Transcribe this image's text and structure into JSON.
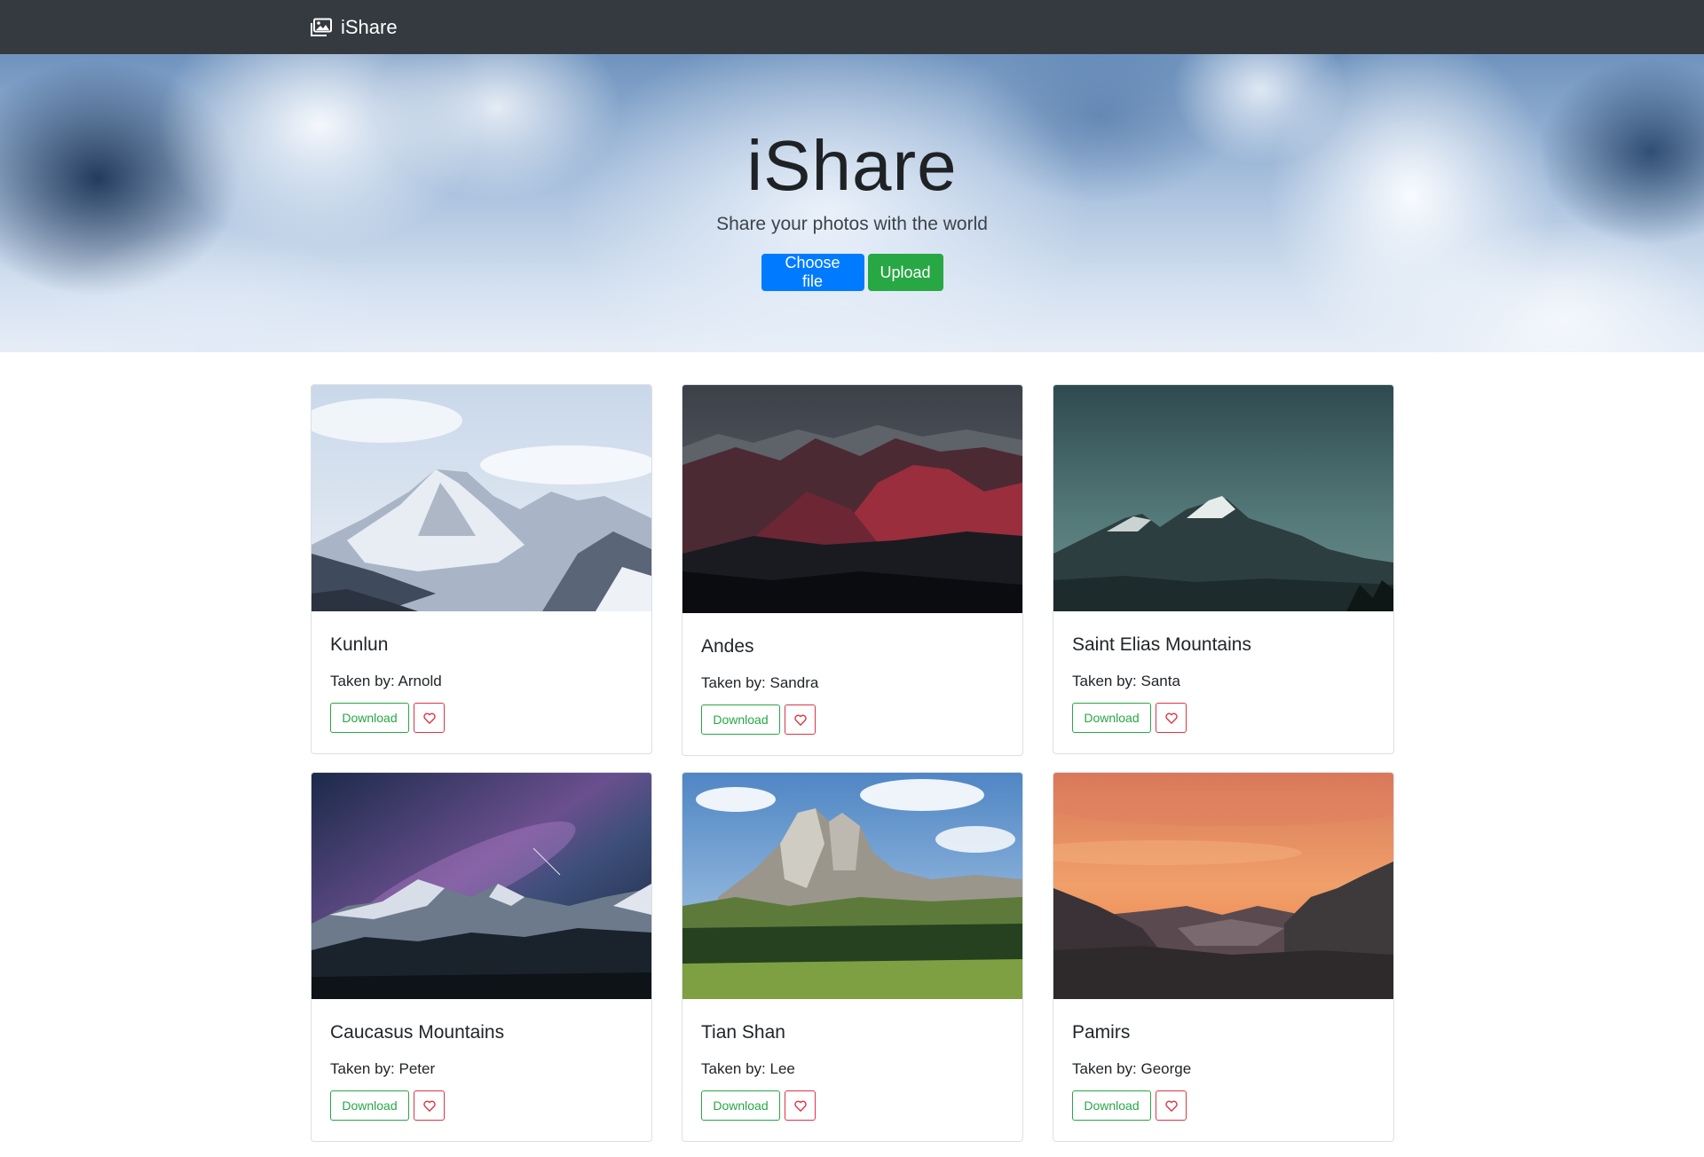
{
  "navbar": {
    "brand_label": "iShare",
    "brand_icon": "images-icon"
  },
  "hero": {
    "title": "iShare",
    "subtitle": "Share your photos with the world",
    "choose_file_label": "Choose file",
    "upload_label": "Upload"
  },
  "cards": [
    {
      "title": "Kunlun",
      "taken_by": "Taken by: Arnold",
      "download_label": "Download",
      "like_icon": "heart-icon"
    },
    {
      "title": "Andes",
      "taken_by": "Taken by: Sandra",
      "download_label": "Download",
      "like_icon": "heart-icon"
    },
    {
      "title": "Saint Elias Mountains",
      "taken_by": "Taken by: Santa",
      "download_label": "Download",
      "like_icon": "heart-icon"
    },
    {
      "title": "Caucasus Mountains",
      "taken_by": "Taken by: Peter",
      "download_label": "Download",
      "like_icon": "heart-icon"
    },
    {
      "title": "Tian Shan",
      "taken_by": "Taken by: Lee",
      "download_label": "Download",
      "like_icon": "heart-icon"
    },
    {
      "title": "Pamirs",
      "taken_by": "Taken by: George",
      "download_label": "Download",
      "like_icon": "heart-icon"
    }
  ],
  "colors": {
    "navbar": "#343a40",
    "primary": "#007bff",
    "success": "#28a745",
    "danger": "#dc3545"
  }
}
